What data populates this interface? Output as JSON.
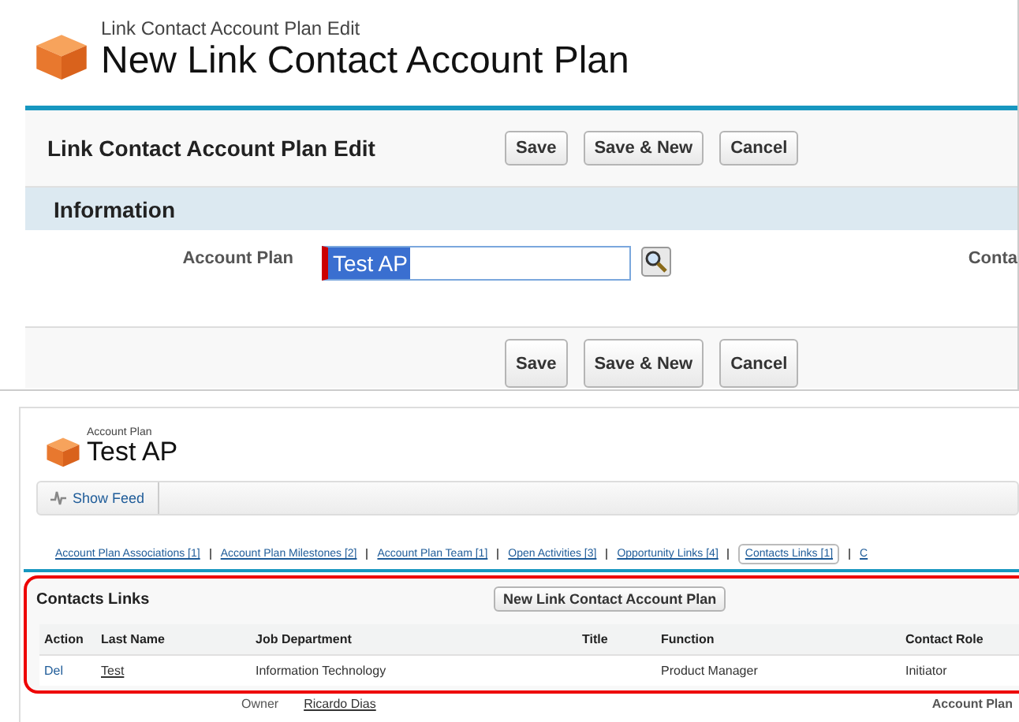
{
  "edit_page": {
    "subtitle": "Link Contact Account Plan Edit",
    "title": "New Link Contact Account Plan",
    "block_title": "Link Contact Account Plan Edit",
    "buttons": [
      "Save",
      "Save & New",
      "Cancel"
    ],
    "section": "Information",
    "fields": [
      {
        "label": "Account Plan",
        "value": "Test AP",
        "required": true
      },
      {
        "label": "Conta"
      }
    ],
    "bottom_buttons": [
      "Save",
      "Save & New",
      "Cancel"
    ]
  },
  "detail_page": {
    "subtitle": "Account Plan",
    "title": "Test AP",
    "feed_button": "Show Feed",
    "related_links": [
      {
        "label": "Account Plan Associations [1]",
        "selected": false
      },
      {
        "label": "Account Plan Milestones [2]",
        "selected": false
      },
      {
        "label": "Account Plan Team [1]",
        "selected": false
      },
      {
        "label": "Open Activities [3]",
        "selected": false
      },
      {
        "label": "Opportunity Links [4]",
        "selected": false
      },
      {
        "label": "Contacts Links [1]",
        "selected": true
      },
      {
        "label": "C",
        "selected": false
      }
    ],
    "related_list": {
      "title": "Contacts Links",
      "new_button": "New Link Contact Account Plan",
      "columns": [
        "Action",
        "Last Name",
        "Job Department",
        "Title",
        "Function",
        "Contact Role"
      ],
      "rows": [
        [
          "Del",
          "Test",
          "Information Technology",
          "",
          "Product Manager",
          "Initiator"
        ]
      ]
    },
    "below": {
      "owner_label": "Owner",
      "owner": "Ricardo Dias",
      "right_label": "Account Plan"
    }
  }
}
